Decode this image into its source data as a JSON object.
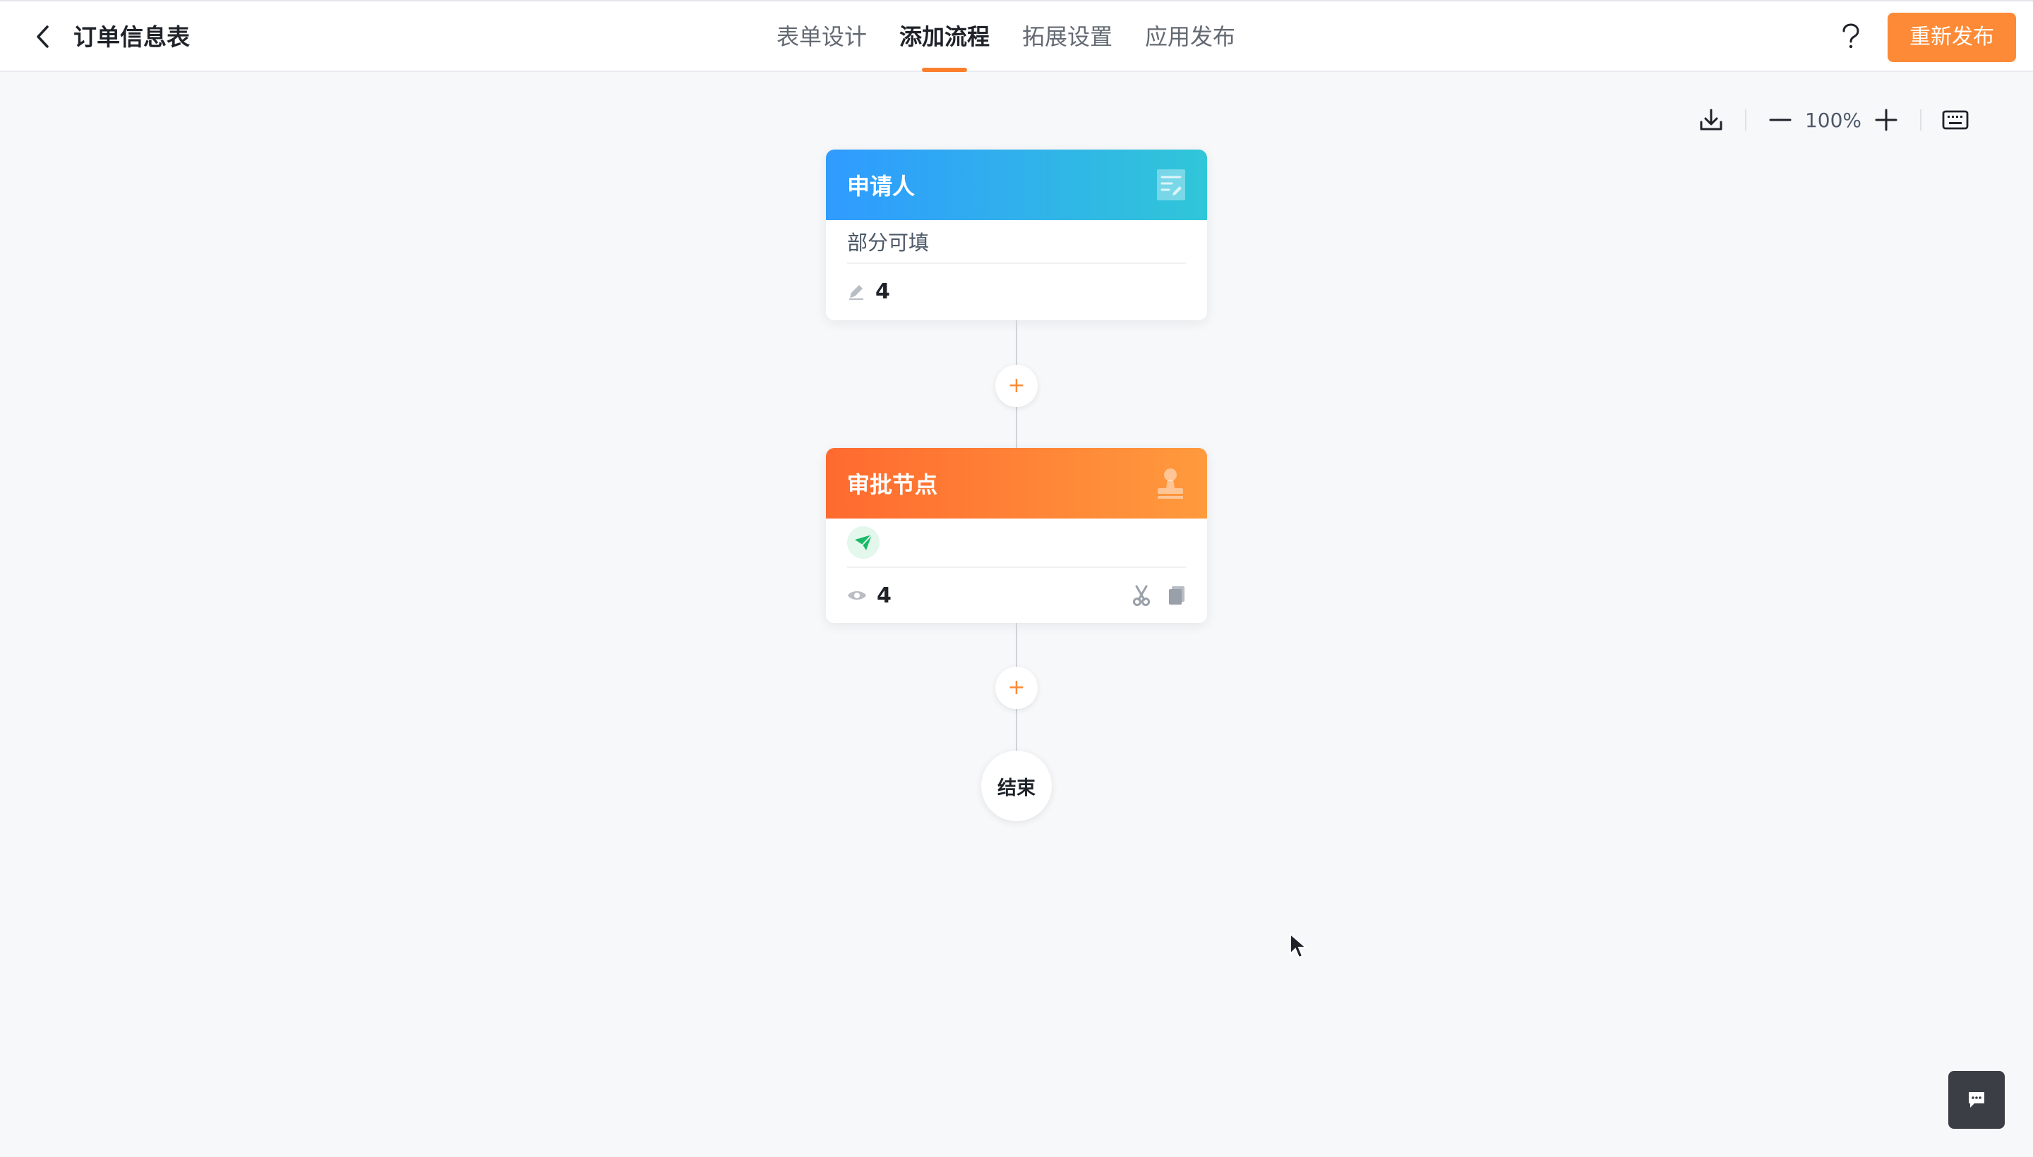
{
  "header": {
    "title": "订单信息表",
    "tabs": [
      {
        "label": "表单设计"
      },
      {
        "label": "添加流程"
      },
      {
        "label": "拓展设置"
      },
      {
        "label": "应用发布"
      }
    ],
    "active_tab": "添加流程",
    "help_icon": "question-icon",
    "republish_label": "重新发布"
  },
  "toolbar": {
    "zoom_label": "100%",
    "icons": [
      "download-icon",
      "zoom-out-icon",
      "zoom-in-icon",
      "keyboard-icon"
    ]
  },
  "flow": {
    "applicant": {
      "title": "申请人",
      "permission": "部分可填",
      "count": "4",
      "header_icon": "form-icon",
      "count_icon": "edit-icon"
    },
    "approval": {
      "title": "审批节点",
      "count": "4",
      "header_icon": "stamp-icon",
      "count_icon": "eye-icon",
      "action_icons": [
        "scissors-icon",
        "copy-icon"
      ],
      "badge_icon": "send-icon"
    },
    "add_label": "+",
    "end_label": "结束"
  },
  "colors": {
    "accent": "#fd8a36",
    "applicant_gradient": [
      "#2f9bff",
      "#30c6d8"
    ],
    "approval_gradient": [
      "#ff6a2f",
      "#ff9a3d"
    ]
  }
}
